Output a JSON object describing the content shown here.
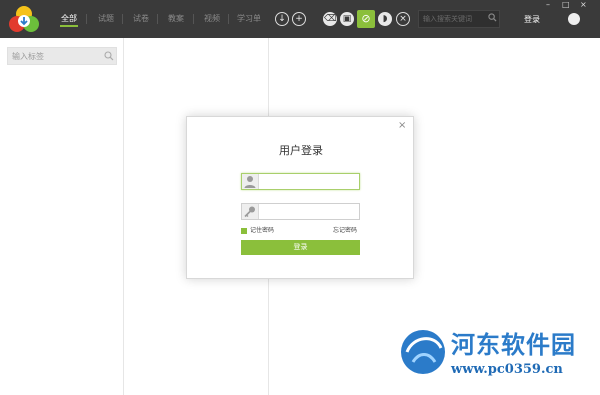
{
  "header": {
    "nav_items": [
      "全部",
      "试题",
      "试卷",
      "教案",
      "视频",
      "学习单"
    ],
    "active_index": 0,
    "search_placeholder": "输入搜索关键词",
    "login_label": "登录",
    "window_controls": [
      "–",
      "□",
      "×"
    ]
  },
  "toolbar": {
    "icons": [
      "download-icon",
      "add-icon",
      "eraser-icon",
      "save-icon",
      "no-entry-icon",
      "shield-icon",
      "close-icon"
    ],
    "active_icon": "no-entry-icon"
  },
  "sidebar": {
    "tag_placeholder": "输入标签"
  },
  "dialog": {
    "title": "用户登录",
    "username_value": "",
    "password_value": "",
    "remember_label": "记住密码",
    "remember_checked": true,
    "forgot_label": "忘记密码",
    "submit_label": "登录",
    "close_glyph": "×"
  },
  "watermark": {
    "title": "河东软件园",
    "url": "www.pc0359.cn"
  },
  "colors": {
    "topbar": "#3a3a3a",
    "accent": "#8bbf3b",
    "watermark": "#2b7bc9"
  }
}
